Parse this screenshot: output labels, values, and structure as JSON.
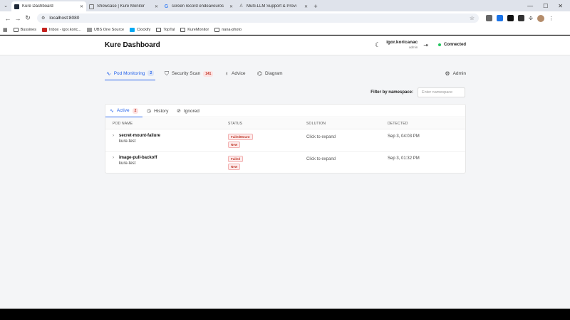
{
  "browser": {
    "tabs": [
      {
        "title": "Kure Dashboard",
        "active": true
      },
      {
        "title": "Showcase | Kure Monitor",
        "active": false
      },
      {
        "title": "screen record endeavouros",
        "active": false
      },
      {
        "title": "Multi-LLM Support & Provi",
        "active": false
      }
    ],
    "url": "localhost:8080",
    "bookmarks": [
      "Bussines",
      "Inbox - igor.koric...",
      "UBS One Source",
      "Clockify",
      "TopTal",
      "KureMonitor",
      "nana-photo"
    ]
  },
  "header": {
    "title": "Kure Dashboard",
    "username": "igor.koricanac",
    "role": "admin",
    "status": "Connected"
  },
  "nav": {
    "tabs": [
      {
        "label": "Pod Monitoring",
        "badge": "2"
      },
      {
        "label": "Security Scan",
        "badge": "141"
      },
      {
        "label": "Advice"
      },
      {
        "label": "Diagram"
      }
    ],
    "admin": "Admin"
  },
  "filter": {
    "label": "Filter by namespace:",
    "placeholder": "Enter namespace"
  },
  "subtabs": [
    {
      "label": "Active",
      "badge": "2"
    },
    {
      "label": "History"
    },
    {
      "label": "Ignored"
    }
  ],
  "table": {
    "columns": [
      "POD NAME",
      "STATUS",
      "SOLUTION",
      "DETECTED"
    ],
    "rows": [
      {
        "name": "secret-mount-failure",
        "namespace": "kure-test",
        "status": "FailedMount",
        "tag": "New",
        "solution": "Click to expand",
        "detected": "Sep 3, 04:03 PM"
      },
      {
        "name": "image-pull-backoff",
        "namespace": "kure-test",
        "status": "Failed",
        "tag": "New",
        "solution": "Click to expand",
        "detected": "Sep 3, 01:32 PM"
      }
    ]
  }
}
